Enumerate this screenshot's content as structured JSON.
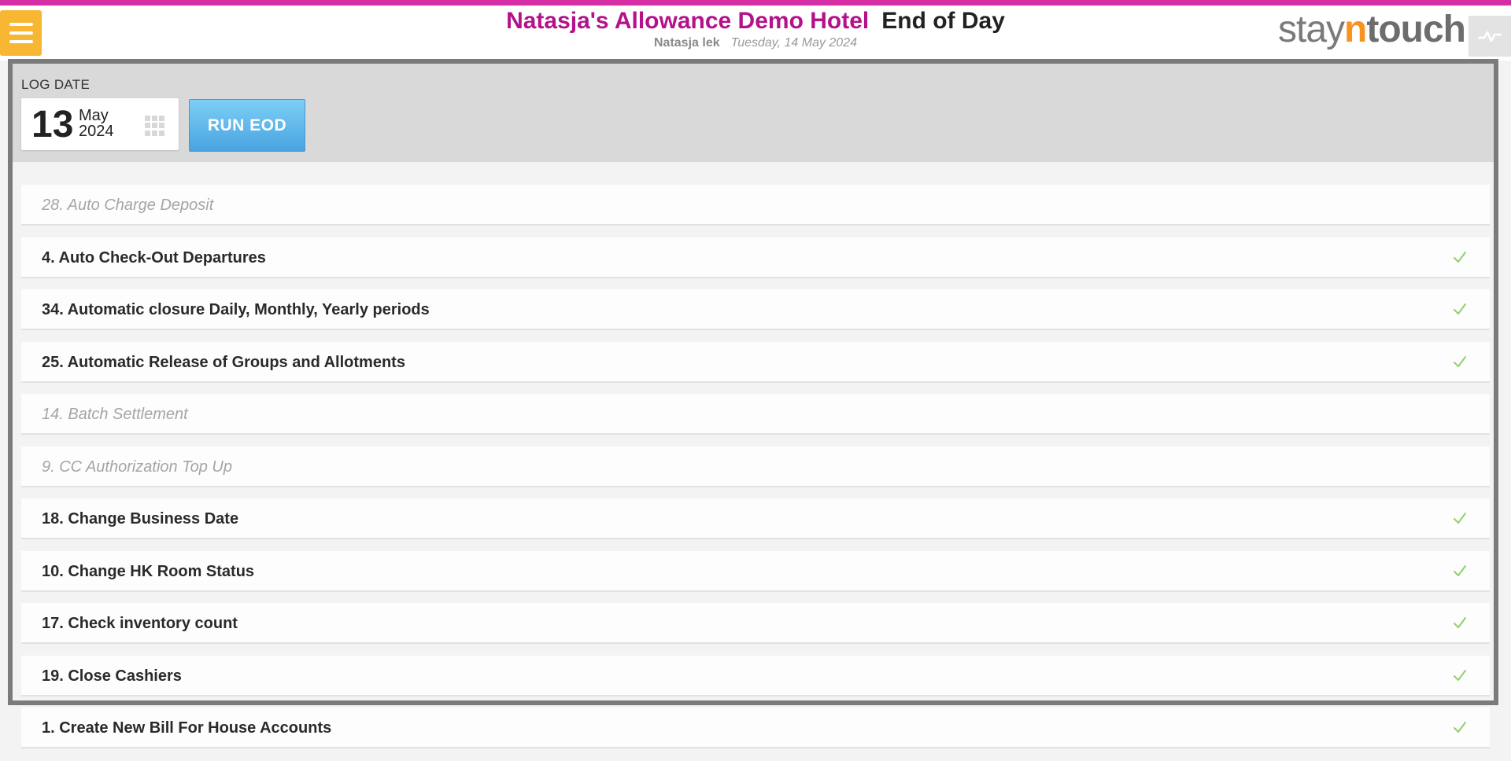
{
  "header": {
    "hotel_name": "Natasja's Allowance Demo Hotel",
    "page_title": "End of Day",
    "user_name": "Natasja lek",
    "current_date": "Tuesday, 14 May 2024",
    "logo": {
      "stay": "stay",
      "n": "n",
      "touch": "touch"
    }
  },
  "log_date": {
    "label": "LOG DATE",
    "day": "13",
    "month": "May",
    "year": "2024"
  },
  "run_button": {
    "label": "RUN EOD"
  },
  "processes": [
    {
      "label": "28. Auto Charge Deposit",
      "enabled": false,
      "checked": false
    },
    {
      "label": "4. Auto Check-Out Departures",
      "enabled": true,
      "checked": true
    },
    {
      "label": "34. Automatic closure Daily, Monthly, Yearly periods",
      "enabled": true,
      "checked": true
    },
    {
      "label": "25. Automatic Release of Groups and Allotments",
      "enabled": true,
      "checked": true
    },
    {
      "label": "14. Batch Settlement",
      "enabled": false,
      "checked": false
    },
    {
      "label": "9. CC Authorization Top Up",
      "enabled": false,
      "checked": false
    },
    {
      "label": "18. Change Business Date",
      "enabled": true,
      "checked": true
    },
    {
      "label": "10. Change HK Room Status",
      "enabled": true,
      "checked": true
    },
    {
      "label": "17. Check inventory count",
      "enabled": true,
      "checked": true
    },
    {
      "label": "19. Close Cashiers",
      "enabled": true,
      "checked": true
    },
    {
      "label": "1. Create New Bill For House Accounts",
      "enabled": true,
      "checked": true
    }
  ],
  "colors": {
    "accent_bar": "#d62fa6",
    "hotel_name": "#b3128a",
    "menu_button": "#f7b733",
    "run_button": "#4aa3e1",
    "check": "#8fd16a"
  },
  "icons": {
    "menu": "hamburger-icon",
    "calendar": "calendar-grid-icon",
    "pulse": "pulse-icon",
    "check": "check-icon"
  }
}
